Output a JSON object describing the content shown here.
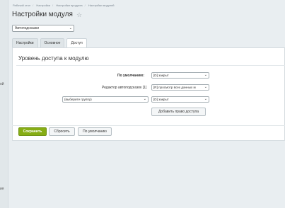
{
  "left_panel": {
    "fragment_1": "ой",
    "fragment_2": "ия"
  },
  "breadcrumb": [
    "Рабочий стол",
    "Настройки",
    "Настройки продукта",
    "Настройки модулей"
  ],
  "page": {
    "title": "Настройки модуля",
    "star_icon": "star-outline-icon"
  },
  "module_select": {
    "value": "Автоподсказки"
  },
  "tabs": [
    {
      "label": "Настройки",
      "active": false
    },
    {
      "label": "Основное",
      "active": false
    },
    {
      "label": "Доступ",
      "active": true
    }
  ],
  "access": {
    "heading": "Уровень доступа к модулю",
    "default_label": "По умолчанию:",
    "default_value": "[D] закрыт",
    "editor_label": "Редактор автоподсказок [1]",
    "editor_value": "[R] просмотр всех данных м",
    "group_placeholder": "(выберите группу)",
    "group_value": "[D] закрыт",
    "add_button": "Добавить право доступа"
  },
  "footer": {
    "save": "Сохранить",
    "reset": "Сбросить",
    "defaults": "По умолчанию"
  },
  "colors": {
    "primary": "#86ad14",
    "background": "#e9eef1"
  }
}
